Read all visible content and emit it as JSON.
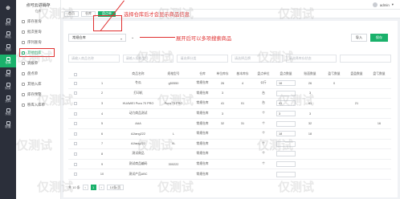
{
  "rail": {
    "logo": "⊕",
    "items": [
      {
        "label": "首页",
        "icon": "home-icon"
      },
      {
        "label": "商品",
        "icon": "goods-icon"
      },
      {
        "label": "采购",
        "icon": "purchase-icon"
      },
      {
        "label": "仓库",
        "icon": "warehouse-icon",
        "active": true
      },
      {
        "label": "销售",
        "icon": "sales-icon"
      },
      {
        "label": "财务",
        "icon": "finance-icon"
      },
      {
        "label": "资料",
        "icon": "data-icon"
      },
      {
        "label": "系统",
        "icon": "system-icon"
      },
      {
        "label": "配置",
        "icon": "config-icon"
      }
    ]
  },
  "submenu": {
    "brand_title": "点可云进销存",
    "brand_subtitle": "仓库",
    "items": [
      "库存查询",
      "批次查询",
      "序列查询",
      "其他出库",
      "调拨单",
      "盘点单",
      "其他入库",
      "库存预警",
      "移库入库单"
    ]
  },
  "topbar": {
    "user": "admin"
  },
  "tabs": [
    "首页",
    "仓库",
    "盘点单"
  ],
  "toolbar": {
    "warehouse": "常规仓库",
    "import_label": "导入",
    "add_label": "保存"
  },
  "filters": [
    "请输入商品名称",
    "请输入规格型号",
    "请选择分类",
    "请选择品牌",
    "请选择库存状态",
    ""
  ],
  "annotations": {
    "top": "选择仓库后才会显示商品信息",
    "middle": "展开后可以多项搜索商品"
  },
  "table": {
    "headers": [
      "",
      "商品名称",
      "规格型号",
      "仓库",
      "单位库存",
      "基本库存",
      "盘点单位",
      "盘点数量",
      "账面数量",
      "盈亏数量",
      "盘盈数量",
      "盘亏数量",
      "备注"
    ],
    "rows": [
      [
        "1",
        "冬瓜",
        "g50550",
        "常规仓库",
        "26",
        "4",
        "公斤",
        "16",
        "26",
        "0",
        "",
        "",
        ""
      ],
      [
        "2",
        "打印机",
        "",
        "常规仓库",
        "3",
        "",
        "台",
        "",
        "3",
        "",
        "",
        "",
        ""
      ],
      [
        "3",
        "HUAWEI Pura 70 PRO",
        "Pura 70 PRO",
        "常规仓库",
        "41",
        "01",
        "台",
        "41",
        "41",
        "",
        "21",
        "",
        ""
      ],
      [
        "4",
        "动力商品测试",
        "",
        "常规仓库",
        "3",
        "",
        "个",
        "3",
        "3",
        "",
        "",
        "",
        ""
      ],
      [
        "5",
        "AAA",
        "",
        "常规仓库",
        "32",
        "31",
        "个",
        "",
        "32",
        "",
        "",
        "16",
        ""
      ],
      [
        "6",
        "AJiang222",
        "L",
        "常规仓库",
        "",
        "",
        "个",
        "18",
        "18",
        "",
        "",
        "",
        ""
      ],
      [
        "7",
        "AJiang222",
        "XL",
        "常规仓库",
        "",
        "",
        "个",
        "",
        "",
        "",
        "",
        "",
        ""
      ],
      [
        "8",
        "测试商品",
        "",
        "常规仓库",
        "",
        "",
        "个",
        "",
        "",
        "",
        "",
        "",
        ""
      ],
      [
        "9",
        "测试商品编码",
        "300222",
        "常规仓库",
        "",
        "",
        "个",
        "",
        "",
        "",
        "",
        "",
        ""
      ],
      [
        "10",
        "测试产品ABC",
        "",
        "常规仓库",
        "",
        "",
        "",
        "",
        "",
        "",
        "",
        "",
        ""
      ]
    ]
  },
  "pager": {
    "total": "共 10 条",
    "page": "1",
    "size": "10条/页"
  },
  "watermark": "仅测试"
}
